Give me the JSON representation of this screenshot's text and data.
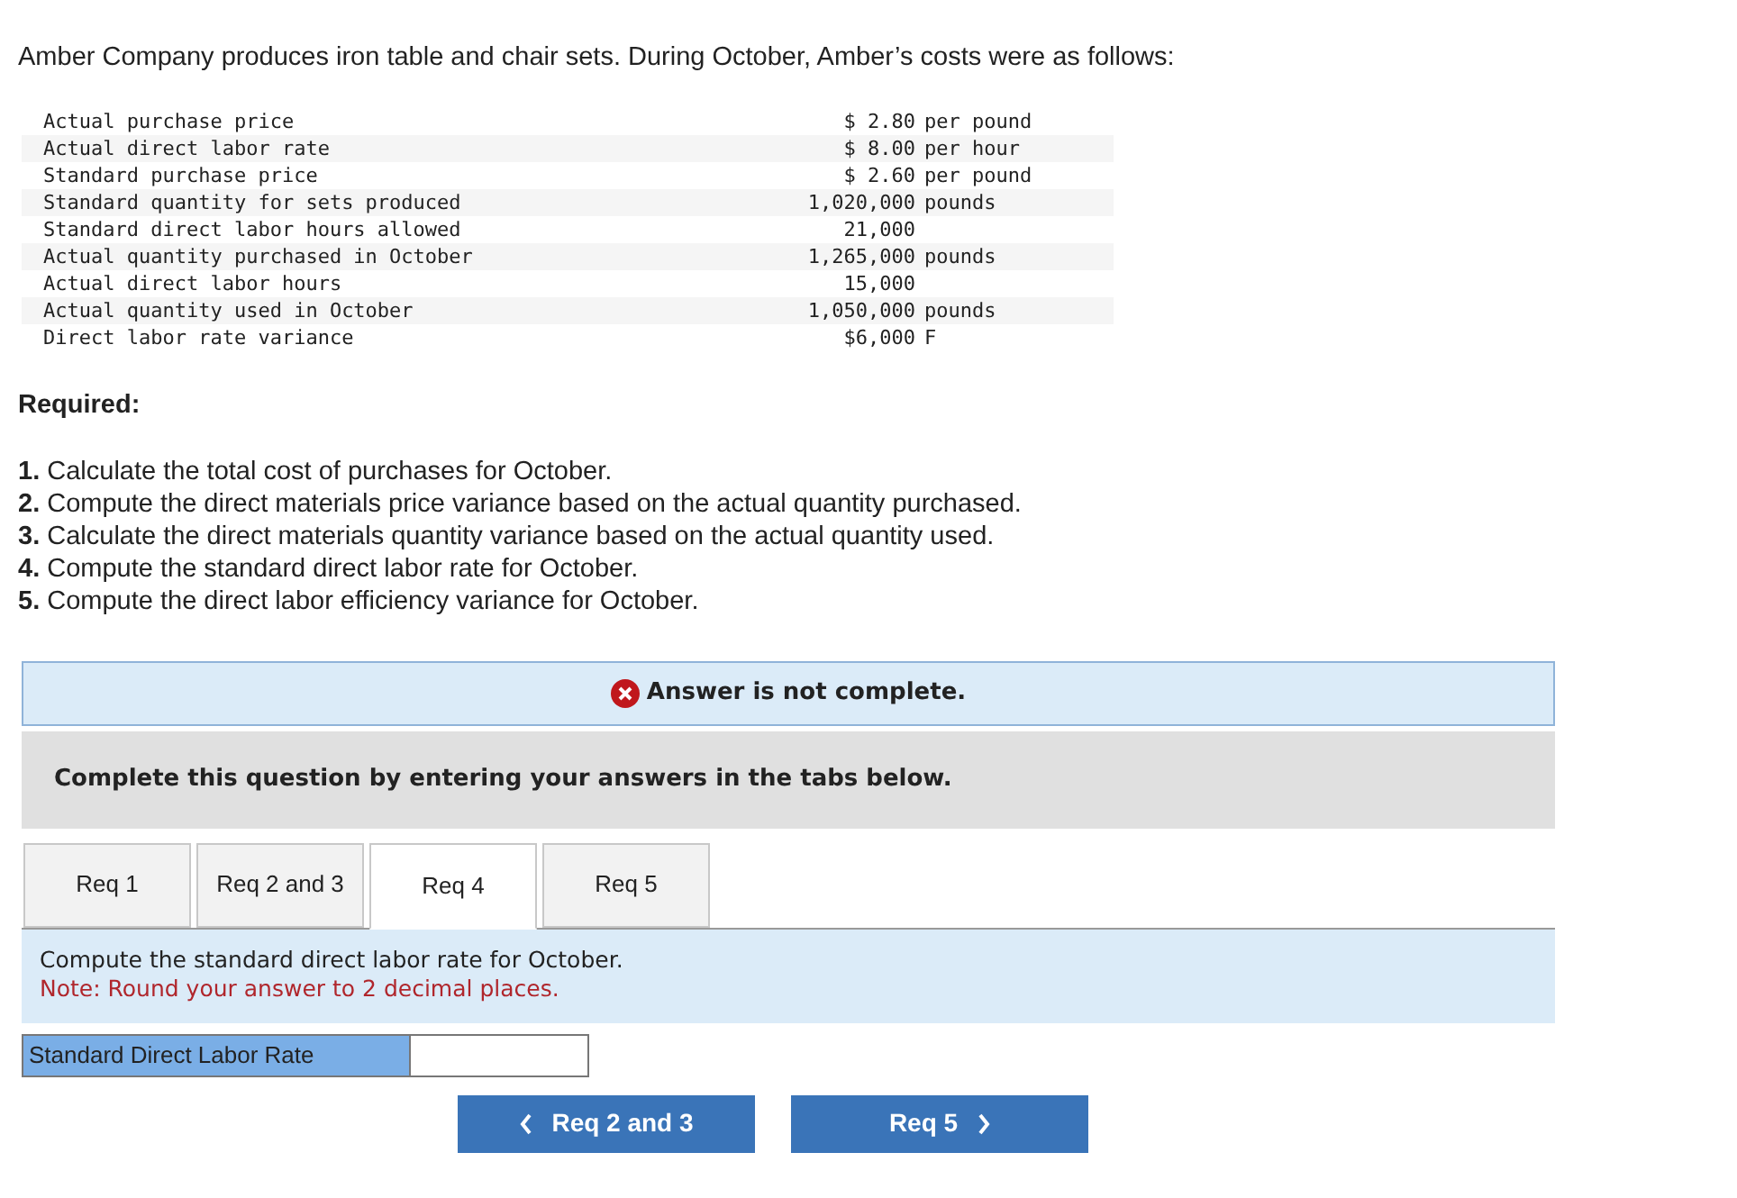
{
  "intro": "Amber Company produces iron table and chair sets. During October, Amber’s costs were as follows:",
  "cost_table": [
    {
      "label": "Actual purchase price",
      "amount": "$ 2.80",
      "unit": "per pound"
    },
    {
      "label": "Actual direct labor rate",
      "amount": "$ 8.00",
      "unit": "per hour"
    },
    {
      "label": "Standard purchase price",
      "amount": "$ 2.60",
      "unit": "per pound"
    },
    {
      "label": "Standard quantity for sets produced",
      "amount": "1,020,000",
      "unit": "pounds"
    },
    {
      "label": "Standard direct labor hours allowed",
      "amount": "21,000"
    },
    {
      "label": "Actual quantity purchased in October",
      "amount": "1,265,000",
      "unit": "pounds"
    },
    {
      "label": "Actual direct labor hours",
      "amount": "15,000"
    },
    {
      "label": "Actual quantity used in October",
      "amount": "1,050,000",
      "unit": "pounds"
    },
    {
      "label": "Direct labor rate variance",
      "amount": "$6,000",
      "unit": "F"
    }
  ],
  "required_heading": "Required:",
  "requirements": [
    "**1.** Calculate the total cost of purchases for October.",
    "**2.** Compute the direct materials price variance based on the actual quantity purchased.",
    "**3.** Calculate the direct materials quantity variance based on the actual quantity used.",
    "**4.** Compute the standard direct labor rate for October.",
    "**5.** Compute the direct labor efficiency variance for October."
  ],
  "status_banner": "Answer is not complete.",
  "instruction": "Complete this question by entering your answers in the tabs below.",
  "tabs": [
    {
      "label": "Req 1",
      "selected": false
    },
    {
      "label": "Req 2 and 3",
      "selected": false
    },
    {
      "label": "Req 4",
      "selected": true
    },
    {
      "label": "Req 5",
      "selected": false
    }
  ],
  "prompt": "Compute the standard direct labor rate for October.",
  "note": "Note: Round your answer to 2 decimal places.",
  "answer_row": {
    "label": "Standard Direct Labor Rate"
  },
  "nav": {
    "prev": "Req 2 and 3",
    "next": "Req 5"
  }
}
